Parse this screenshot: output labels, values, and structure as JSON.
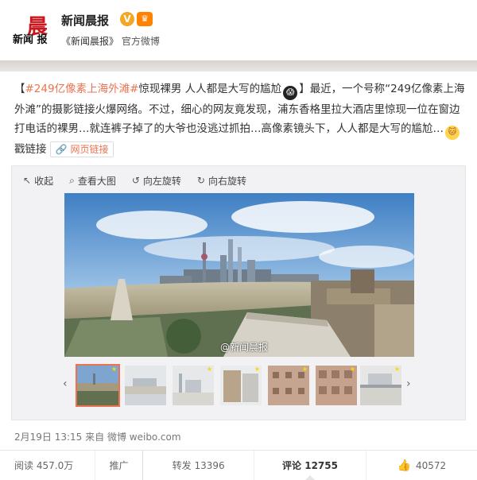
{
  "account": {
    "logo_big": "晨",
    "logo_small": "新闻 报",
    "name": "新闻晨报",
    "verified_mark": "V",
    "source_link": "《新闻晨报》",
    "source_suffix": " 官方微博"
  },
  "post": {
    "hashtag": "#249亿像素上海外滩#",
    "text1": "惊现裸男 人人都是大写的尴尬",
    "emoji1": "😱",
    "text2": "最近，一个号称“249亿像素上海外滩”的摄影链接火爆网络。不过，细心的网友竟发现，浦东香格里拉大酒店里惊现一位在窗边打电话的裸男…就连裤子掉了的大爷也没逃过抓拍…高像素镜头下，人人都是大写的尴尬…",
    "emoji2": "🐱",
    "text3": "戳链接",
    "weblink_icon": "🔗",
    "weblink_label": "网页链接"
  },
  "media": {
    "toolbar": {
      "collapse": "收起",
      "view_large": "查看大图",
      "rotate_left": "向左旋转",
      "rotate_right": "向右旋转"
    },
    "watermark": "@新闻晨报",
    "thumb_count_visible": 7,
    "active_thumb": 1
  },
  "meta": {
    "date": "2月19日",
    "time": "13:15",
    "via": "来自 微博 weibo.com"
  },
  "footer": {
    "read_label": "阅读",
    "read_count": "457.0万",
    "promo": "推广",
    "repost_label": "转发",
    "repost_count": "13396",
    "comment_label": "评论",
    "comment_count": "12755",
    "like_count": "40572"
  },
  "colors": {
    "hashtag": "#eb7350",
    "badge_v": "#f5a623",
    "active_thumb_border": "#eb7350"
  }
}
